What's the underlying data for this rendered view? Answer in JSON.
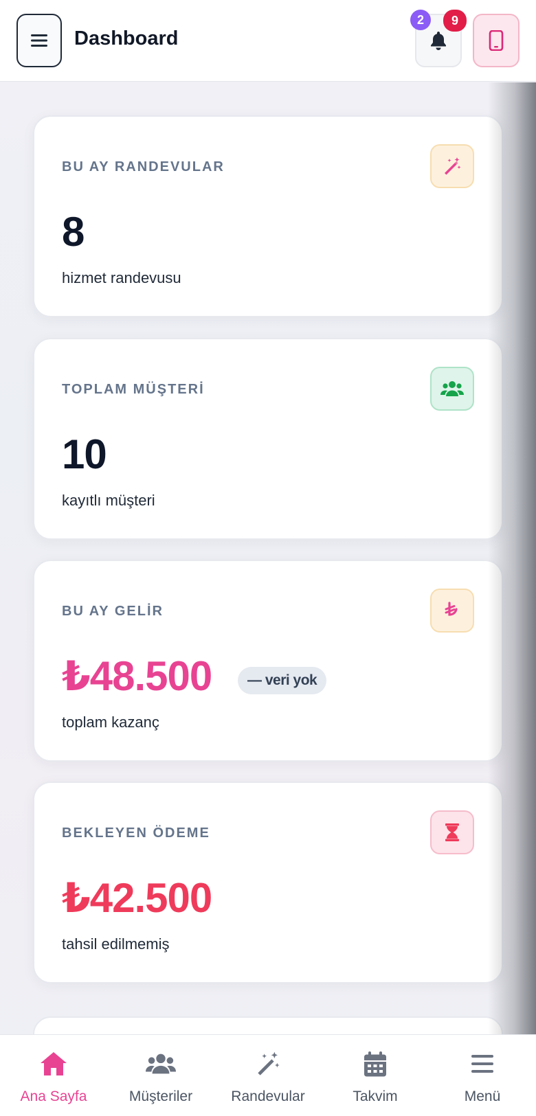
{
  "header": {
    "title": "Dashboard",
    "notification_badges": [
      "2",
      "9"
    ]
  },
  "cards": [
    {
      "label": "BU AY RANDEVULAR",
      "value": "8",
      "subtitle": "hizmet randevusu",
      "icon": "magic-wand-icon",
      "icon_color": "#e84393"
    },
    {
      "label": "TOPLAM MÜŞTERİ",
      "value": "10",
      "subtitle": "kayıtlı müşteri",
      "icon": "users-icon",
      "icon_color": "#16a34a"
    },
    {
      "label": "BU AY GELİR",
      "value": "₺48.500",
      "pill": "— veri yok",
      "subtitle": "toplam kazanç",
      "icon": "lira-icon",
      "icon_color": "#e84393"
    },
    {
      "label": "BEKLEYEN ÖDEME",
      "value": "₺42.500",
      "subtitle": "tahsil edilmemiş",
      "icon": "hourglass-icon",
      "icon_color": "#ef3b5b"
    }
  ],
  "bottom_nav": [
    {
      "label": "Ana Sayfa",
      "icon": "home-icon",
      "active": true
    },
    {
      "label": "Müşteriler",
      "icon": "users-icon",
      "active": false
    },
    {
      "label": "Randevular",
      "icon": "magic-wand-icon",
      "active": false
    },
    {
      "label": "Takvim",
      "icon": "calendar-icon",
      "active": false
    },
    {
      "label": "Menü",
      "icon": "menu-icon",
      "active": false
    }
  ],
  "colors": {
    "accent": "#e84393",
    "danger": "#ef3b5b",
    "badge_purple": "#8b5cf6",
    "badge_red": "#e11d48"
  }
}
